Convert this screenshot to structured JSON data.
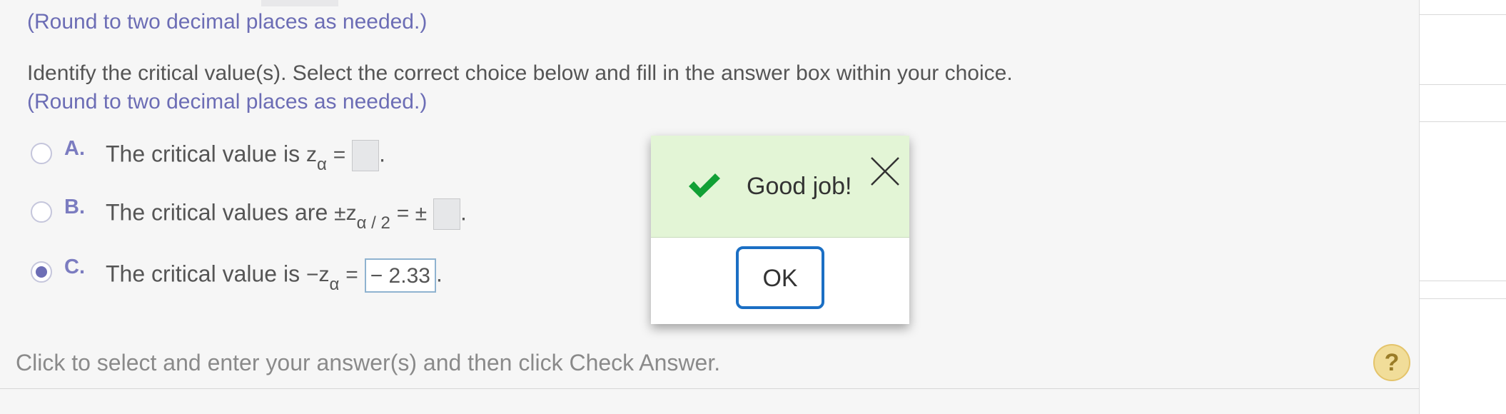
{
  "hints": {
    "round_top": "(Round to two decimal places as needed.)",
    "round_mid": "(Round to two decimal places as needed.)"
  },
  "prompt": "Identify the critical value(s). Select the correct choice below and fill in the answer box within your choice.",
  "choices": [
    {
      "letter": "A.",
      "text": "The critical value is",
      "var": "z",
      "sub": "α",
      "eq": "=",
      "selected": false
    },
    {
      "letter": "B.",
      "text": "The critical values are",
      "pre": "±",
      "var": "z",
      "sub": "α / 2",
      "eq": "= ±",
      "selected": false
    },
    {
      "letter": "C.",
      "text": "The critical value is",
      "pre": "−",
      "var": "z",
      "sub": "α",
      "eq": "=",
      "answer": "− 2.33",
      "selected": true
    }
  ],
  "period": ".",
  "footer": "Click to select and enter your answer(s) and then click Check Answer.",
  "help_label": "?",
  "dialog": {
    "message": "Good job!",
    "ok_label": "OK",
    "icon": "checkmark-icon",
    "accent": "#1b6fc4",
    "success_color": "#11a035"
  }
}
